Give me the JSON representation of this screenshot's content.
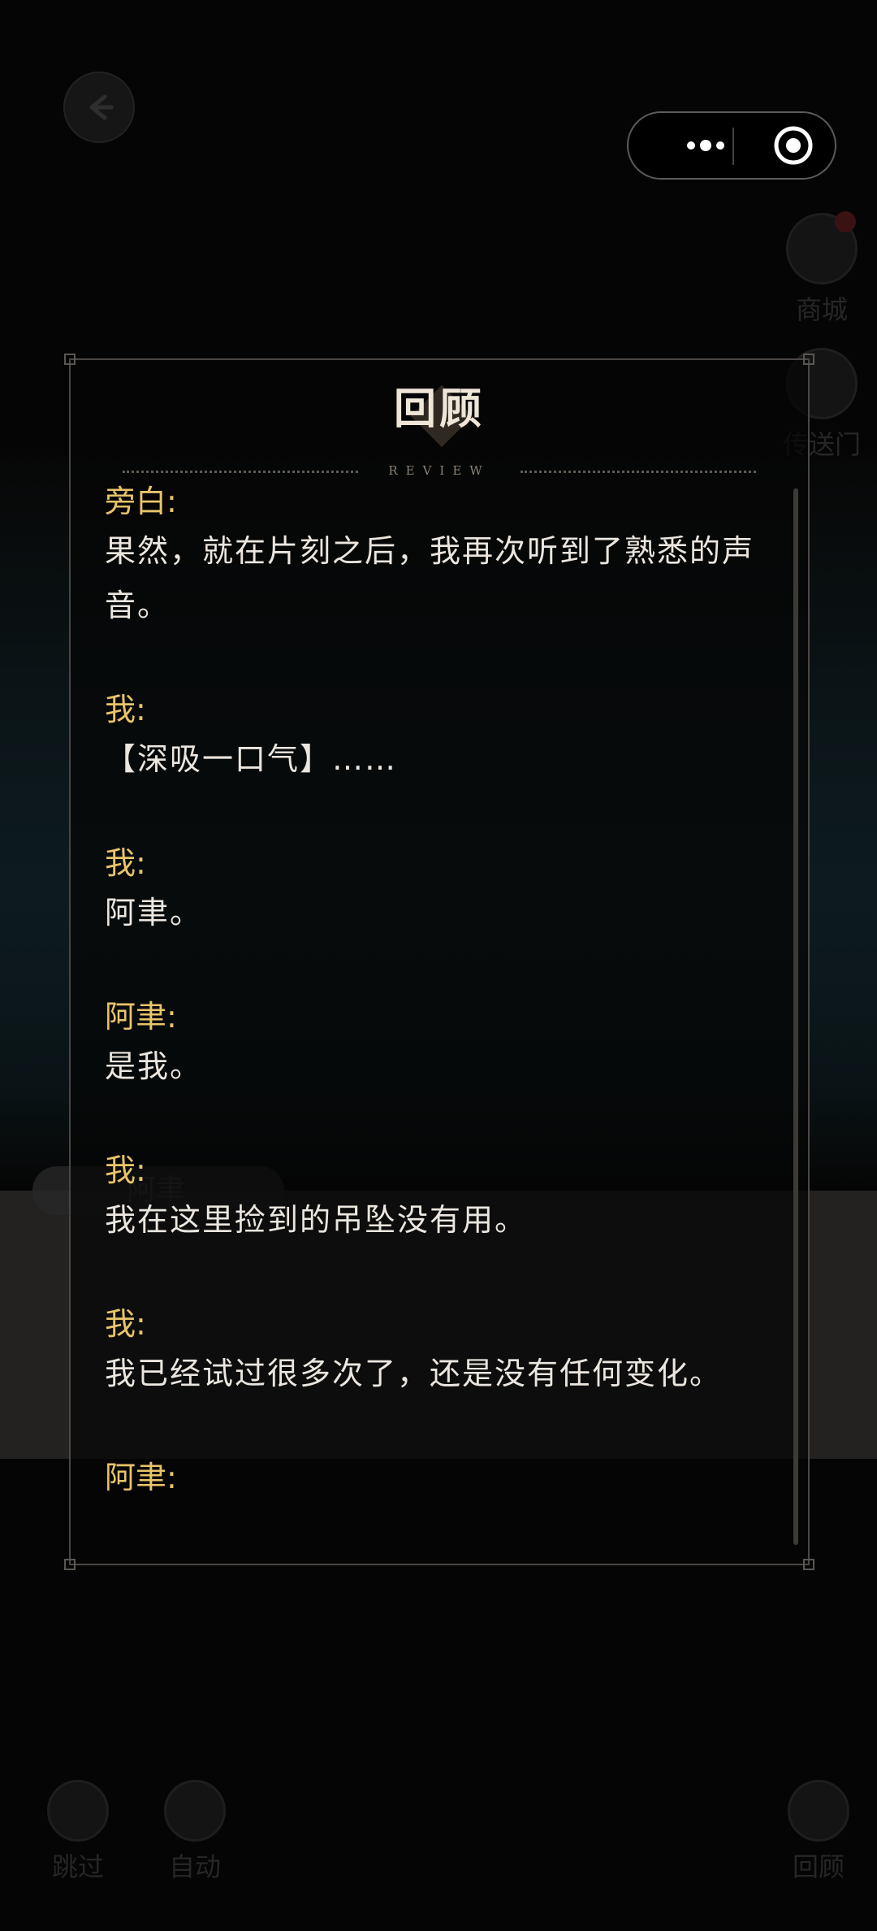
{
  "panel": {
    "title": "回顾",
    "subtitle": "REVIEW"
  },
  "entries": [
    {
      "speaker": "旁白:",
      "text": "果然，就在片刻之后，我再次听到了熟悉的声音。"
    },
    {
      "speaker": "我:",
      "text": "【深吸一口气】……"
    },
    {
      "speaker": "我:",
      "text": "阿聿。"
    },
    {
      "speaker": "阿聿:",
      "text": "是我。"
    },
    {
      "speaker": "我:",
      "text": "我在这里捡到的吊坠没有用。"
    },
    {
      "speaker": "我:",
      "text": "我已经试过很多次了，还是没有任何变化。"
    },
    {
      "speaker": "阿聿:",
      "text": ""
    }
  ],
  "background": {
    "name_tag": "阿聿"
  },
  "side_buttons": {
    "shop": "商城",
    "portal": "传送门"
  },
  "bottom_buttons": {
    "skip": "跳过",
    "auto": "自动",
    "review": "回顾"
  },
  "icons": [
    "back-arrow-icon",
    "more-dots-icon",
    "close-target-icon",
    "shop-icon",
    "portal-icon",
    "skip-icon",
    "play-icon",
    "clock-icon"
  ],
  "colors": {
    "speaker": "#e8c46a",
    "text": "#ebe6df",
    "panel_border": "#4a4744"
  }
}
